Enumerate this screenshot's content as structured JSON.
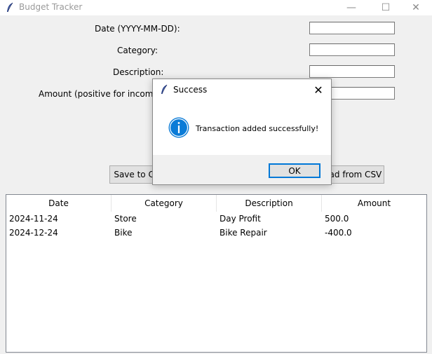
{
  "window": {
    "title": "Budget Tracker",
    "minimize_glyph": "—",
    "maximize_glyph": "☐",
    "close_glyph": "✕",
    "icon": "feather-icon"
  },
  "form": {
    "date_label": "Date (YYYY-MM-DD):",
    "category_label": "Category:",
    "description_label": "Description:",
    "amount_label": "Amount (positive for income, n",
    "date_value": "",
    "category_value": "",
    "description_value": "",
    "amount_value": ""
  },
  "buttons": {
    "save_csv": "Save to CSV",
    "load_csv": "Load from CSV"
  },
  "table": {
    "columns": [
      "Date",
      "Category",
      "Description",
      "Amount"
    ],
    "rows": [
      [
        "2024-11-24",
        "Store",
        "Day Profit",
        "500.0"
      ],
      [
        "2024-12-24",
        "Bike",
        "Bike Repair",
        "-400.0"
      ]
    ]
  },
  "dialog": {
    "title": "Success",
    "message": "Transaction added successfully!",
    "ok_label": "OK",
    "close_glyph": "✕",
    "icon": "info-icon"
  },
  "colors": {
    "accent": "#0078d7",
    "info_icon": "#0a7bd7"
  }
}
